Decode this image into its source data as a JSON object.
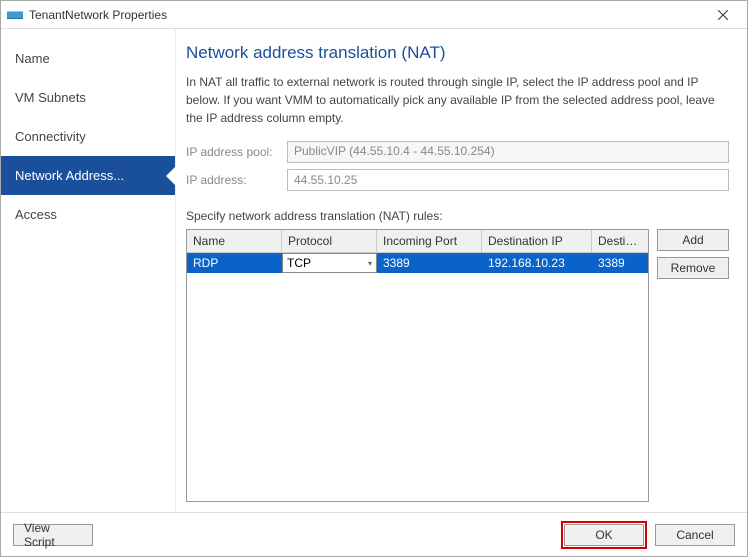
{
  "window": {
    "title": "TenantNetwork Properties"
  },
  "sidebar": {
    "items": [
      {
        "label": "Name"
      },
      {
        "label": "VM Subnets"
      },
      {
        "label": "Connectivity"
      },
      {
        "label": "Network Address..."
      },
      {
        "label": "Access"
      }
    ],
    "selected_index": 3
  },
  "main": {
    "heading": "Network address translation (NAT)",
    "description": "In NAT all traffic to external network is routed through single IP, select the IP address pool and IP below. If you want VMM to automatically pick any available IP from the selected address pool, leave the IP address column empty.",
    "pool_label": "IP address pool:",
    "pool_value": "PublicVIP (44.55.10.4 - 44.55.10.254)",
    "ip_label": "IP address:",
    "ip_value": "44.55.10.25",
    "rules_label": "Specify network address translation (NAT) rules:",
    "grid": {
      "columns": [
        "Name",
        "Protocol",
        "Incoming Port",
        "Destination IP",
        "Destination P..."
      ],
      "rows": [
        {
          "name": "RDP",
          "protocol": "TCP",
          "incoming_port": "3389",
          "dest_ip": "192.168.10.23",
          "dest_port": "3389"
        }
      ]
    },
    "buttons": {
      "add": "Add",
      "remove": "Remove"
    }
  },
  "footer": {
    "view_script": "View Script",
    "ok": "OK",
    "cancel": "Cancel"
  }
}
